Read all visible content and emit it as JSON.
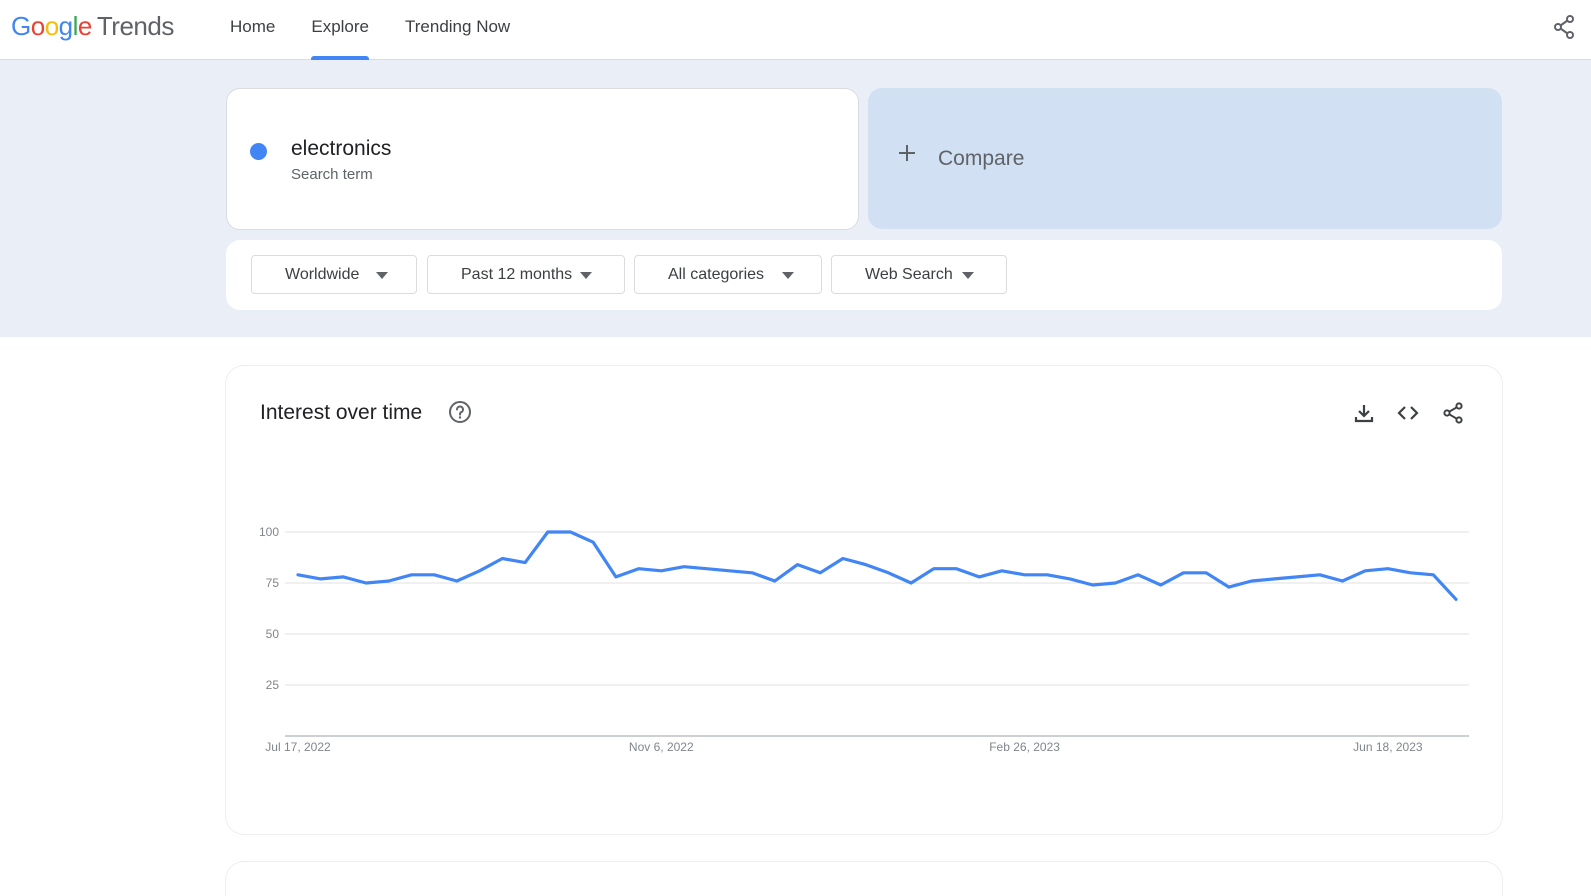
{
  "header": {
    "logo_letters": [
      "G",
      "o",
      "o",
      "g",
      "l",
      "e"
    ],
    "logo_suffix": "Trends",
    "nav": [
      {
        "label": "Home",
        "active": false
      },
      {
        "label": "Explore",
        "active": true
      },
      {
        "label": "Trending Now",
        "active": false
      }
    ]
  },
  "search": {
    "term": "electronics",
    "term_type": "Search term",
    "term_color": "#4285f4",
    "compare_label": "Compare"
  },
  "filters": {
    "region": "Worldwide",
    "time_range": "Past 12 months",
    "category": "All categories",
    "search_type": "Web Search"
  },
  "interest_card": {
    "title": "Interest over time",
    "icons": [
      "help-icon",
      "download-icon",
      "embed-icon",
      "share-icon"
    ]
  },
  "chart_data": {
    "type": "line",
    "xlabel": "",
    "ylabel": "",
    "ylim": [
      0,
      100
    ],
    "yticks": [
      25,
      50,
      75,
      100
    ],
    "x_tick_labels": [
      "Jul 17, 2022",
      "Nov 6, 2022",
      "Feb 26, 2023",
      "Jun 18, 2023"
    ],
    "x_tick_dates": [
      "2022-07-17",
      "2022-11-06",
      "2023-02-26",
      "2023-06-18"
    ],
    "grid": true,
    "series": [
      {
        "color": "#4285f4",
        "x": [
          "2022-07-17",
          "2022-07-24",
          "2022-07-31",
          "2022-08-07",
          "2022-08-14",
          "2022-08-21",
          "2022-08-28",
          "2022-09-04",
          "2022-09-11",
          "2022-09-18",
          "2022-09-25",
          "2022-10-02",
          "2022-10-09",
          "2022-10-16",
          "2022-10-23",
          "2022-10-30",
          "2022-11-06",
          "2022-11-13",
          "2022-11-20",
          "2022-11-27",
          "2022-12-04",
          "2022-12-11",
          "2022-12-18",
          "2022-12-25",
          "2023-01-01",
          "2023-01-08",
          "2023-01-15",
          "2023-01-22",
          "2023-01-29",
          "2023-02-05",
          "2023-02-12",
          "2023-02-19",
          "2023-02-26",
          "2023-03-05",
          "2023-03-12",
          "2023-03-19",
          "2023-03-26",
          "2023-04-02",
          "2023-04-09",
          "2023-04-16",
          "2023-04-23",
          "2023-04-30",
          "2023-05-07",
          "2023-05-14",
          "2023-05-21",
          "2023-05-28",
          "2023-06-04",
          "2023-06-11",
          "2023-06-18",
          "2023-06-25",
          "2023-07-02",
          "2023-07-09"
        ],
        "values": [
          79,
          77,
          78,
          75,
          76,
          79,
          79,
          76,
          81,
          87,
          85,
          100,
          100,
          95,
          78,
          82,
          81,
          83,
          82,
          81,
          80,
          76,
          84,
          80,
          87,
          84,
          80,
          75,
          82,
          82,
          78,
          81,
          79,
          79,
          77,
          74,
          75,
          79,
          74,
          80,
          80,
          73,
          76,
          77,
          78,
          79,
          76,
          81,
          82,
          80,
          79,
          67
        ]
      }
    ]
  }
}
